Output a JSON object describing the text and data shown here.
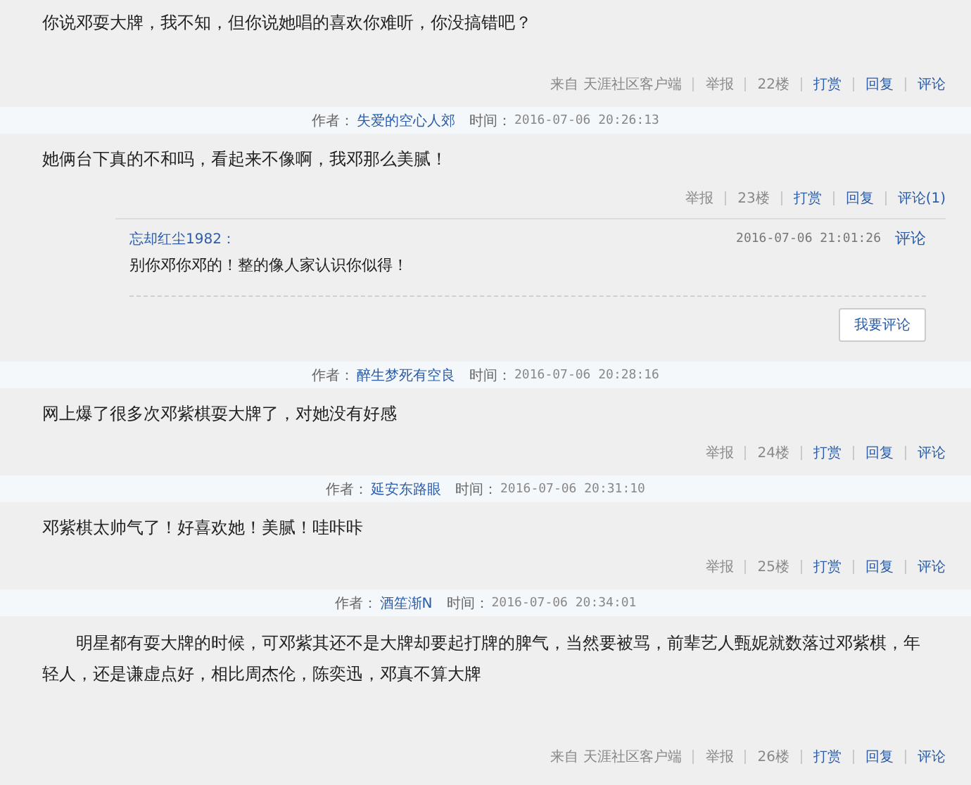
{
  "posts": [
    {
      "content": "你说邓耍大牌，我不知，但你说她唱的喜欢你难听，你没搞错吧？",
      "footer": [
        {
          "text": "来自 天涯社区客户端",
          "kind": "plain"
        },
        {
          "text": "举报",
          "kind": "plain"
        },
        {
          "text": "22楼",
          "kind": "plain"
        },
        {
          "text": "打赏",
          "kind": "link"
        },
        {
          "text": "回复",
          "kind": "link"
        },
        {
          "text": "评论",
          "kind": "link"
        }
      ]
    },
    {
      "author_label": "作者：",
      "author": "失爱的空心人郊",
      "time_label": "时间：",
      "time": "2016-07-06 20:26:13",
      "content": "她俩台下真的不和吗，看起来不像啊，我邓那么美腻！",
      "footer": [
        {
          "text": "举报",
          "kind": "plain"
        },
        {
          "text": "23楼",
          "kind": "plain"
        },
        {
          "text": "打赏",
          "kind": "link"
        },
        {
          "text": "回复",
          "kind": "link"
        },
        {
          "text": "评论(1)",
          "kind": "link"
        }
      ],
      "comments": [
        {
          "author": "忘却红尘1982：",
          "time": "2016-07-06 21:01:26",
          "action": "评论",
          "text": "别你邓你邓的！整的像人家认识你似得！"
        }
      ],
      "comment_button": "我要评论"
    },
    {
      "author_label": "作者：",
      "author": "醉生梦死有空良",
      "time_label": "时间：",
      "time": "2016-07-06 20:28:16",
      "content": "网上爆了很多次邓紫棋耍大牌了，对她没有好感",
      "footer": [
        {
          "text": "举报",
          "kind": "plain"
        },
        {
          "text": "24楼",
          "kind": "plain"
        },
        {
          "text": "打赏",
          "kind": "link"
        },
        {
          "text": "回复",
          "kind": "link"
        },
        {
          "text": "评论",
          "kind": "link"
        }
      ]
    },
    {
      "author_label": "作者：",
      "author": "延安东路眼",
      "time_label": "时间：",
      "time": "2016-07-06 20:31:10",
      "content": "邓紫棋太帅气了！好喜欢她！美腻！哇咔咔",
      "footer": [
        {
          "text": "举报",
          "kind": "plain"
        },
        {
          "text": "25楼",
          "kind": "plain"
        },
        {
          "text": "打赏",
          "kind": "link"
        },
        {
          "text": "回复",
          "kind": "link"
        },
        {
          "text": "评论",
          "kind": "link"
        }
      ]
    },
    {
      "author_label": "作者：",
      "author": "酒笙渐N",
      "time_label": "时间：",
      "time": "2016-07-06 20:34:01",
      "content": "明星都有耍大牌的时候，可邓紫其还不是大牌却要起打牌的脾气，当然要被骂，前辈艺人甄妮就数落过邓紫棋，年轻人，还是谦虚点好，相比周杰伦，陈奕迅，邓真不算大牌",
      "indent": true,
      "footer": [
        {
          "text": "来自 天涯社区客户端",
          "kind": "plain"
        },
        {
          "text": "举报",
          "kind": "plain"
        },
        {
          "text": "26楼",
          "kind": "plain"
        },
        {
          "text": "打赏",
          "kind": "link"
        },
        {
          "text": "回复",
          "kind": "link"
        },
        {
          "text": "评论",
          "kind": "link"
        }
      ]
    }
  ]
}
